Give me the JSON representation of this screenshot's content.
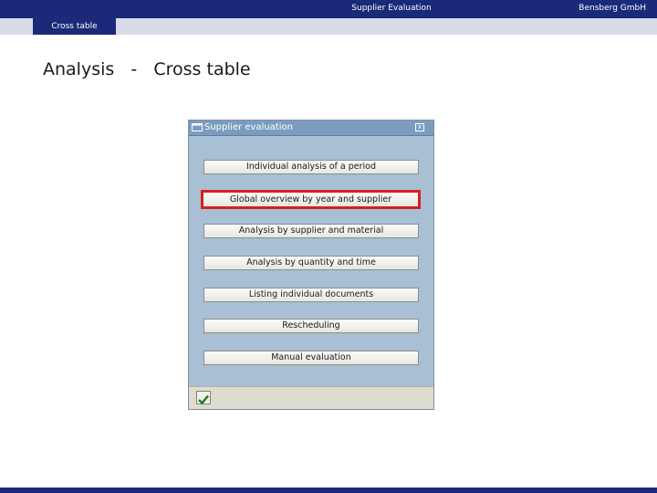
{
  "header": {
    "center_title": "Supplier Evaluation",
    "company": "Bensberg GmbH",
    "active_tab": "Cross table"
  },
  "page": {
    "heading": "Analysis   -   Cross table"
  },
  "dialog": {
    "title": "Supplier evaluation",
    "buttons": [
      {
        "label": "Individual analysis of a period",
        "highlighted": false
      },
      {
        "label": "Global overview by year and supplier",
        "highlighted": true
      },
      {
        "label": "Analysis by supplier and material",
        "highlighted": false
      },
      {
        "label": "Analysis by quantity and time",
        "highlighted": false
      },
      {
        "label": "Listing individual documents",
        "highlighted": false
      },
      {
        "label": "Rescheduling",
        "highlighted": false
      },
      {
        "label": "Manual evaluation",
        "highlighted": false
      }
    ],
    "highlight_color": "#d51f1f",
    "footer_icon": "checkmark-icon"
  },
  "colors": {
    "brand_navy": "#1a2a78",
    "dialog_bg": "#a9bfd3"
  }
}
